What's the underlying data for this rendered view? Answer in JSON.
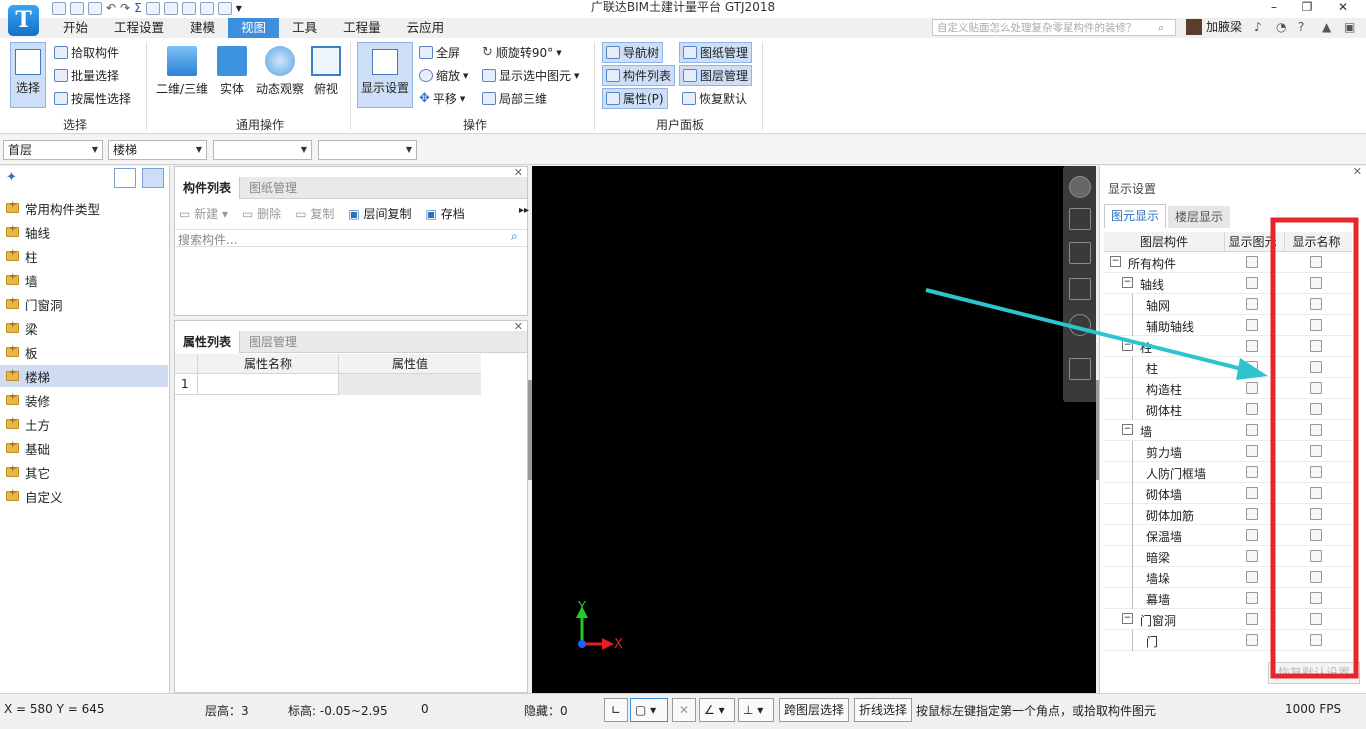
{
  "title": "广联达BIM土建计量平台 GTJ2018",
  "logo_letter": "T",
  "menu": [
    {
      "label": "开始"
    },
    {
      "label": "工程设置"
    },
    {
      "label": "建模"
    },
    {
      "label": "视图",
      "active": true
    },
    {
      "label": "工具"
    },
    {
      "label": "工程量"
    },
    {
      "label": "云应用"
    }
  ],
  "search": {
    "placeholder": "自定义贴面怎么处理复杂零星构件的装修？"
  },
  "user": {
    "name": "加腋梁"
  },
  "ribbon": {
    "select": {
      "big": "选择",
      "items": [
        "拾取构件",
        "批量选择",
        "按属性选择"
      ],
      "group": "选择"
    },
    "common": {
      "buttons": [
        "二维/三维",
        "实体",
        "动态观察",
        "俯视"
      ],
      "group": "通用操作"
    },
    "ops": {
      "big": "显示设置",
      "col1": [
        "全屏",
        "缩放",
        "平移"
      ],
      "col2": [
        "顺旋转90°",
        "显示选中图元",
        "局部三维"
      ],
      "group": "操作"
    },
    "panel": {
      "col1": [
        "导航树",
        "构件列表",
        "属性(P)"
      ],
      "col2": [
        "图纸管理",
        "图层管理",
        "恢复默认"
      ],
      "group": "用户面板"
    }
  },
  "combos": [
    "首层",
    "楼梯",
    "",
    ""
  ],
  "tree": [
    {
      "label": "常用构件类型"
    },
    {
      "label": "轴线"
    },
    {
      "label": "柱"
    },
    {
      "label": "墙"
    },
    {
      "label": "门窗洞"
    },
    {
      "label": "梁"
    },
    {
      "label": "板"
    },
    {
      "label": "楼梯",
      "selected": true
    },
    {
      "label": "装修"
    },
    {
      "label": "土方"
    },
    {
      "label": "基础"
    },
    {
      "label": "其它"
    },
    {
      "label": "自定义"
    }
  ],
  "component_panel": {
    "tabs": [
      "构件列表",
      "图纸管理"
    ],
    "toolbar": [
      "新建",
      "删除",
      "复制",
      "层间复制",
      "存档"
    ],
    "search_placeholder": "搜索构件..."
  },
  "property_panel": {
    "tabs": [
      "属性列表",
      "图层管理"
    ],
    "columns": [
      "属性名称",
      "属性值"
    ],
    "row_index": "1"
  },
  "axes": {
    "y": "Y",
    "x": "X"
  },
  "display_settings": {
    "title": "显示设置",
    "tabs": [
      "图元显示",
      "楼层显示"
    ],
    "columns": [
      "图层构件",
      "显示图元",
      "显示名称"
    ],
    "rows": [
      {
        "label": "所有构件",
        "level": 0,
        "expander": "−"
      },
      {
        "label": "轴线",
        "level": 1,
        "expander": "−"
      },
      {
        "label": "轴网",
        "level": 2
      },
      {
        "label": "辅助轴线",
        "level": 2
      },
      {
        "label": "柱",
        "level": 1,
        "expander": "−"
      },
      {
        "label": "柱",
        "level": 2
      },
      {
        "label": "构造柱",
        "level": 2
      },
      {
        "label": "砌体柱",
        "level": 2
      },
      {
        "label": "墙",
        "level": 1,
        "expander": "−"
      },
      {
        "label": "剪力墙",
        "level": 2
      },
      {
        "label": "人防门框墙",
        "level": 2
      },
      {
        "label": "砌体墙",
        "level": 2
      },
      {
        "label": "砌体加筋",
        "level": 2
      },
      {
        "label": "保温墙",
        "level": 2
      },
      {
        "label": "暗梁",
        "level": 2
      },
      {
        "label": "墙垛",
        "level": 2
      },
      {
        "label": "幕墙",
        "level": 2
      },
      {
        "label": "门窗洞",
        "level": 1,
        "expander": "−"
      },
      {
        "label": "门",
        "level": 2
      }
    ],
    "restore_button": "恢复默认设置"
  },
  "status": {
    "coords": "X = 580 Y = 645",
    "floor_height": "层高：3",
    "elevation": "标高: -0.05~2.95",
    "count": "0",
    "hidden": "隐藏：0",
    "cross_layer": "跨图层选择",
    "polyline": "折线选择",
    "hint": "按鼠标左键指定第一个角点，或拾取构件图元",
    "fps": "1000 FPS"
  },
  "colors": {
    "accent": "#3b8fdc",
    "highlight_box": "#e8242e",
    "arrow": "#2ec4cf",
    "viewport": "#000000"
  }
}
